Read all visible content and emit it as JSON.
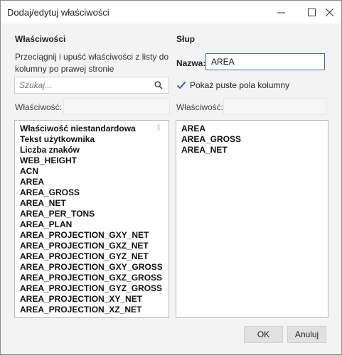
{
  "window": {
    "title": "Dodaj/edytuj właściwości"
  },
  "left": {
    "heading": "Właściwości",
    "hint": "Przeciągnij i upuść właściwości z listy do kolumny po prawej stronie",
    "search_placeholder": "Szukaj...",
    "property_label": "Właściwość:",
    "items": [
      "Właściwość niestandardowa",
      "Tekst użytkownika",
      "Liczba znaków",
      "WEB_HEIGHT",
      "ACN",
      "AREA",
      "AREA_GROSS",
      "AREA_NET",
      "AREA_PER_TONS",
      "AREA_PLAN",
      "AREA_PROJECTION_GXY_NET",
      "AREA_PROJECTION_GXZ_NET",
      "AREA_PROJECTION_GYZ_NET",
      "AREA_PROJECTION_GXY_GROSS",
      "AREA_PROJECTION_GXZ_GROSS",
      "AREA_PROJECTION_GYZ_GROSS",
      "AREA_PROJECTION_XY_NET",
      "AREA_PROJECTION_XZ_NET"
    ]
  },
  "right": {
    "heading": "Słup",
    "name_label": "Nazwa:",
    "name_value": "AREA",
    "show_empty_label": "Pokaż puste pola kolumny",
    "show_empty_checked": true,
    "property_label": "Właściwość:",
    "items": [
      "AREA",
      "AREA_GROSS",
      "AREA_NET"
    ]
  },
  "buttons": {
    "ok": "OK",
    "cancel": "Anuluj"
  },
  "colors": {
    "accent": "#1f5fa8",
    "focus_border": "#3a6fa8"
  }
}
